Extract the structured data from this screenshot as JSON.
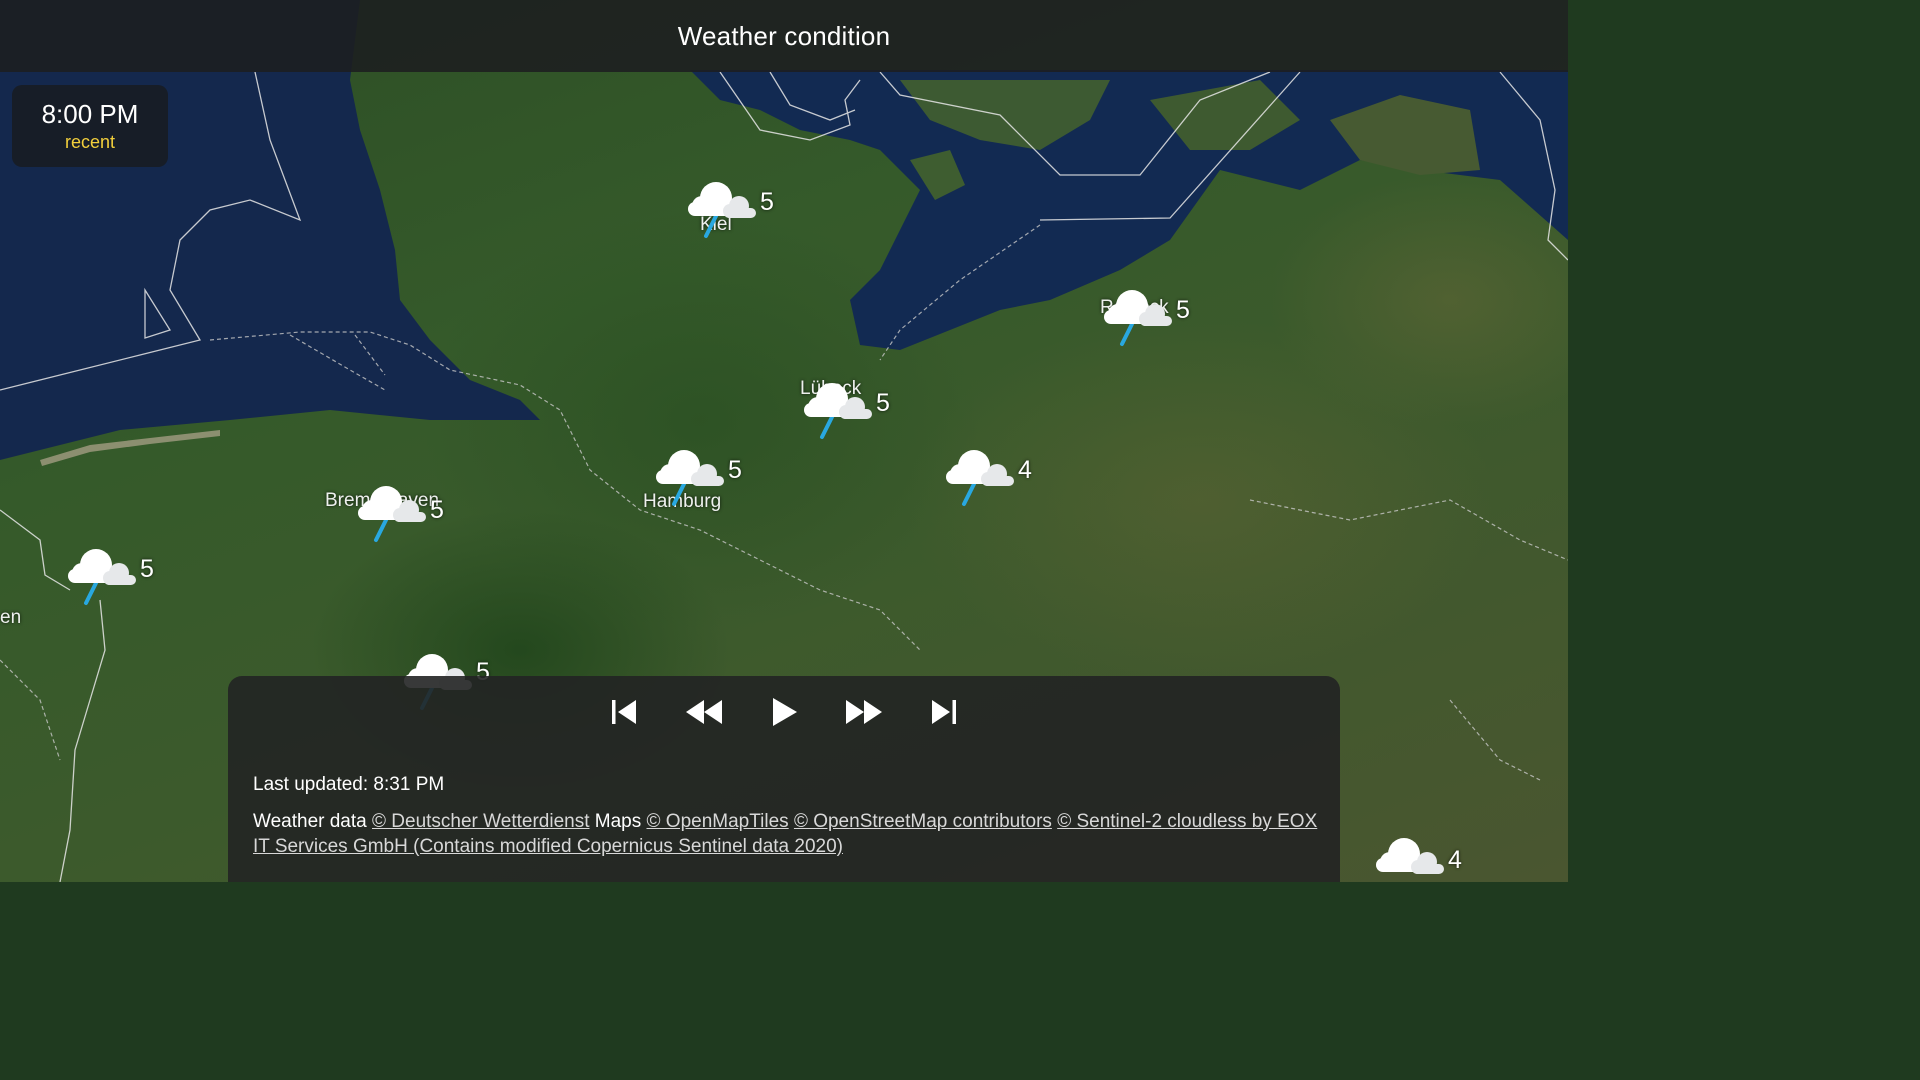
{
  "header": {
    "title": "Weather condition"
  },
  "time_chip": {
    "time": "8:00 PM",
    "status": "recent"
  },
  "places": [
    {
      "name": "Kiel"
    },
    {
      "name": "Hamburg"
    },
    {
      "name": "Bremerhaven"
    },
    {
      "name": "Lübeck"
    },
    {
      "name": "Rostock"
    },
    {
      "name": "en"
    }
  ],
  "markers": [
    {
      "icon": "cloud-rain-icon",
      "value": "5"
    },
    {
      "icon": "cloud-rain-icon",
      "value": "5"
    },
    {
      "icon": "cloud-rain-icon",
      "value": "5"
    },
    {
      "icon": "cloud-rain-icon",
      "value": "5"
    },
    {
      "icon": "cloud-rain-icon",
      "value": "4"
    },
    {
      "icon": "cloud-rain-icon",
      "value": "5"
    },
    {
      "icon": "cloud-rain-icon",
      "value": "5"
    },
    {
      "icon": "cloud-rain-icon",
      "value": "5"
    },
    {
      "icon": "cloud-icon",
      "value": "4"
    }
  ],
  "controls": {
    "buttons": [
      "skip-to-start",
      "rewind",
      "play",
      "fast-forward",
      "skip-to-end"
    ]
  },
  "footer": {
    "last_updated": "Last updated: 8:31 PM",
    "weather_prefix": "Weather data",
    "dwd_link": "© Deutscher Wetterdienst",
    "maps_prefix": "Maps",
    "omt_link": "© OpenMapTiles",
    "osm_link": "© OpenStreetMap contributors",
    "sentinel_link": "© Sentinel-2 cloudless by EOX IT Services GmbH (Contains modified Copernicus Sentinel data 2020)"
  },
  "colors": {
    "accent_recent": "#f2cf3c",
    "rain_drop": "#29a8e0",
    "sea": "#13264a",
    "land": "#355a2a"
  }
}
